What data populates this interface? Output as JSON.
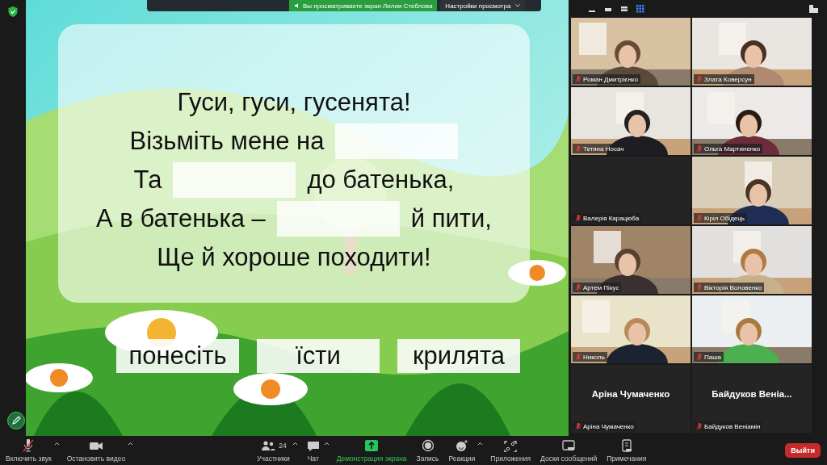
{
  "banner": {
    "text": "Вы просматриваете экран Лилии Стеблова",
    "settings": "Настройки просмотра"
  },
  "slide": {
    "lines": [
      {
        "parts": [
          {
            "kind": "text",
            "text": "Гуси, гуси, гусенята!"
          }
        ]
      },
      {
        "parts": [
          {
            "kind": "text",
            "text": "Візьміть мене на"
          },
          {
            "kind": "blank"
          }
        ]
      },
      {
        "parts": [
          {
            "kind": "text",
            "text": "Та"
          },
          {
            "kind": "blank"
          },
          {
            "kind": "text",
            "text": "до батенька,"
          }
        ]
      },
      {
        "parts": [
          {
            "kind": "text",
            "text": "А в батенька –"
          },
          {
            "kind": "blank"
          },
          {
            "kind": "text",
            "text": "й пити,"
          }
        ]
      },
      {
        "parts": [
          {
            "kind": "text",
            "text": "Ще й хороше походити!"
          }
        ]
      }
    ],
    "choices": [
      "понесіть",
      "їсти",
      "крилята"
    ]
  },
  "view_buttons": [
    {
      "kind": "minimize",
      "selected": false
    },
    {
      "kind": "strip",
      "selected": false
    },
    {
      "kind": "speaker",
      "selected": false
    },
    {
      "kind": "gallery",
      "selected": true
    }
  ],
  "gallery": {
    "tiles": [
      {
        "kind": "video",
        "name": "Роман Дмитрієнко",
        "muted": true
      },
      {
        "kind": "video",
        "name": "Злата Коверсун",
        "muted": true
      },
      {
        "kind": "video",
        "name": "Тетяна Носач",
        "muted": true
      },
      {
        "kind": "video",
        "name": "Ольга Мартиненко",
        "muted": true
      },
      {
        "kind": "blank",
        "name": "Валерія Карацюба",
        "muted": true
      },
      {
        "kind": "video",
        "name": "Кіріл Обідець",
        "muted": true
      },
      {
        "kind": "video",
        "name": "Артем Пікус",
        "muted": true
      },
      {
        "kind": "video",
        "name": "Вікторія Воловенко",
        "muted": true
      },
      {
        "kind": "video",
        "name": "Николь",
        "muted": true
      },
      {
        "kind": "video",
        "name": "Паша",
        "muted": true
      },
      {
        "kind": "name",
        "display_name": "Аріна Чумаченко",
        "name": "Аріна Чумаченко",
        "muted": true
      },
      {
        "kind": "name",
        "display_name": "Байдуков Веніа...",
        "name": "Байдуков Веніамін",
        "muted": true
      }
    ]
  },
  "toolbar": {
    "items": [
      {
        "kind": "mic",
        "label": "Включить звук",
        "muted": true,
        "caret": true
      },
      {
        "kind": "video",
        "label": "Остановить видео",
        "caret": true
      },
      {
        "kind": "participants",
        "label": "Участники",
        "count": "24",
        "caret": true
      },
      {
        "kind": "chat",
        "label": "Чат",
        "caret": true
      },
      {
        "kind": "share",
        "label": "Демонстрация экрана",
        "active": true,
        "caret": false
      },
      {
        "kind": "record",
        "label": "Запись",
        "caret": false
      },
      {
        "kind": "reactions",
        "label": "Реакции",
        "caret": true
      },
      {
        "kind": "apps",
        "label": "Приложения",
        "caret": false
      },
      {
        "kind": "boards",
        "label": "Доски сообщений",
        "caret": false
      },
      {
        "kind": "notes",
        "label": "Примечания",
        "caret": false
      }
    ],
    "leave": "Выйти"
  }
}
